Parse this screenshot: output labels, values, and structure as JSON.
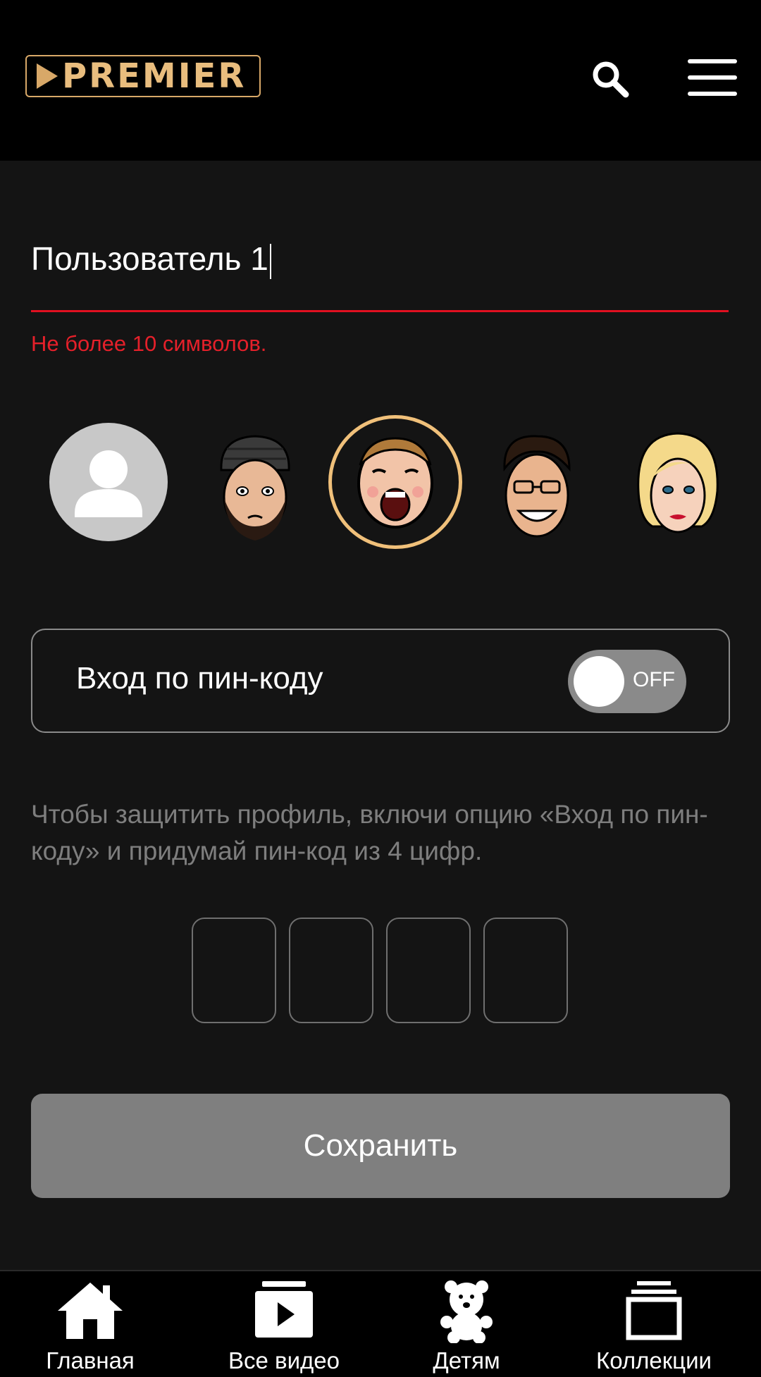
{
  "header": {
    "logo_text": "PREMIER",
    "search_icon": "search-icon",
    "menu_icon": "hamburger-menu-icon",
    "logo_color": "#e9bd7e"
  },
  "profile": {
    "name_value": "Пользователь 1",
    "error_text": "Не более 10 символов.",
    "avatars": [
      {
        "name": "default-avatar",
        "selected": false
      },
      {
        "name": "avatar-beanie-man",
        "selected": false
      },
      {
        "name": "avatar-laughing-man",
        "selected": true
      },
      {
        "name": "avatar-smiling-man",
        "selected": false
      },
      {
        "name": "avatar-blonde-woman",
        "selected": false
      }
    ]
  },
  "pin": {
    "toggle_label": "Вход по пин-коду",
    "toggle_state": "OFF",
    "hint": "Чтобы защитить профиль, включи опцию «Вход по пин-коду» и придумай пин-код из 4 цифр.",
    "digits": [
      "",
      "",
      "",
      ""
    ]
  },
  "actions": {
    "save_label": "Сохранить"
  },
  "tabbar": {
    "items": [
      {
        "label": "Главная",
        "icon": "home-icon"
      },
      {
        "label": "Все видео",
        "icon": "play-video-icon"
      },
      {
        "label": "Детям",
        "icon": "teddy-bear-icon"
      },
      {
        "label": "Коллекции",
        "icon": "collections-stack-icon"
      }
    ]
  },
  "colors": {
    "accent_error": "#e5202a",
    "selected_ring": "#f0c07a",
    "background": "#141414"
  }
}
